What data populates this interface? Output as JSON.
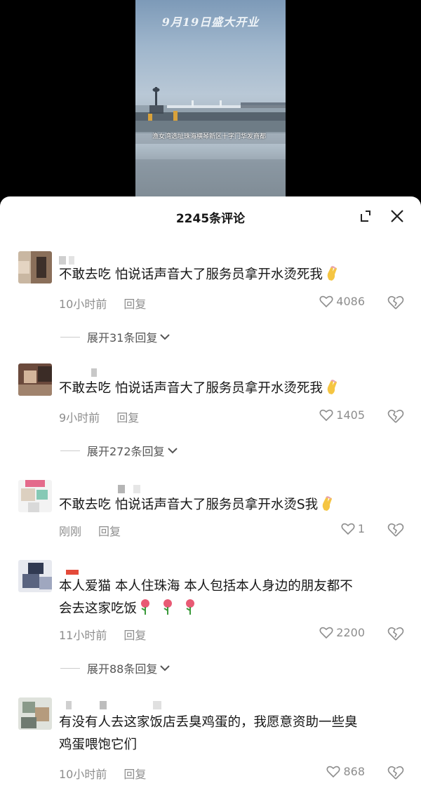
{
  "video": {
    "title": "9月19日盛大开业",
    "caption": "渔女湾选址珠海横琴新区十字门华发商都"
  },
  "header": {
    "comment_count": "2245条评论"
  },
  "comments": [
    {
      "text": "不敢去吃 怕说话声音大了服务员拿开水烫死我",
      "time": "10小时前",
      "reply": "回复",
      "likes": "4086",
      "expand": "展开31条回复"
    },
    {
      "text": "不敢去吃 怕说话声音大了服务员拿开水烫死我",
      "time": "9小时前",
      "reply": "回复",
      "likes": "1405",
      "expand": "展开272条回复"
    },
    {
      "text": "不敢去吃 怕说话声音大了服务员拿开水烫S我",
      "time": "刚刚",
      "reply": "回复",
      "likes": "1"
    },
    {
      "text_line1": "本人爱猫  本人住珠海  本人包括本人身边的朋友都不",
      "text_line2": "会去这家吃饭",
      "time": "11小时前",
      "reply": "回复",
      "likes": "2200",
      "expand": "展开88条回复"
    },
    {
      "text_line1": "有没有人去这家饭店丢臭鸡蛋的，我愿意资助一些臭",
      "text_line2": "鸡蛋喂饱它们",
      "time": "10小时前",
      "reply": "回复",
      "likes": "868"
    }
  ],
  "colors": {
    "text": "#161616",
    "meta": "#8d8d8d",
    "sheet": "#ffffff"
  }
}
